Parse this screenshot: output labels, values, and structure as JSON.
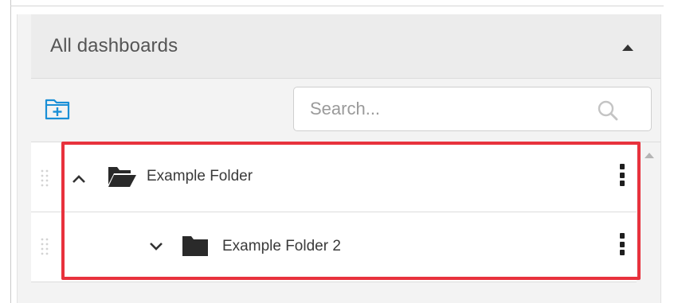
{
  "panel": {
    "title": "All dashboards",
    "collapse_icon": "caret-up-icon"
  },
  "toolbar": {
    "new_folder_icon": "folder-plus-icon",
    "search": {
      "placeholder": "Search...",
      "value": "",
      "icon": "search-icon"
    }
  },
  "tree": {
    "items": [
      {
        "label": "Example Folder",
        "state": "expanded",
        "chevron_icon": "chevron-up-icon",
        "folder_icon": "folder-open-icon",
        "menu_icon": "kebab-menu-icon",
        "level": 0
      },
      {
        "label": "Example Folder 2",
        "state": "collapsed",
        "chevron_icon": "chevron-down-icon",
        "folder_icon": "folder-icon",
        "menu_icon": "kebab-menu-icon",
        "level": 1
      }
    ]
  },
  "colors": {
    "highlight": "#e8323d",
    "accent_icon": "#1a8fd6",
    "folder": "#2a2a2a",
    "panel_bg": "#f3f3f3"
  }
}
